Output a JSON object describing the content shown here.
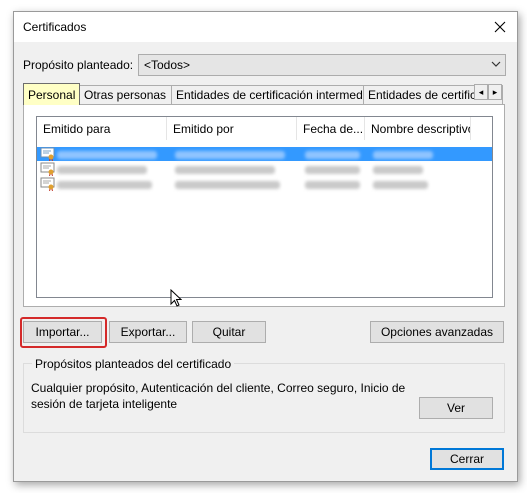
{
  "window": {
    "title": "Certificados",
    "close_glyph": "✕"
  },
  "purpose": {
    "label": "Propósito planteado:",
    "value": "<Todos>"
  },
  "tabs": [
    {
      "label": "Personal"
    },
    {
      "label": "Otras personas"
    },
    {
      "label": "Entidades de certificación intermedias"
    },
    {
      "label": "Entidades de certificaci"
    }
  ],
  "tab_scroll": {
    "left_glyph": "◂",
    "right_glyph": "▸"
  },
  "list": {
    "columns": [
      "Emitido para",
      "Emitido por",
      "Fecha de...",
      "Nombre descriptivo"
    ],
    "rows": [
      {
        "selected": true,
        "icon": "certificate-icon"
      },
      {
        "selected": false,
        "icon": "certificate-icon"
      },
      {
        "selected": false,
        "icon": "certificate-icon"
      }
    ]
  },
  "buttons": {
    "import": "Importar...",
    "export": "Exportar...",
    "remove": "Quitar",
    "advanced": "Opciones avanzadas",
    "view": "Ver",
    "close": "Cerrar"
  },
  "purposes_group": {
    "title": "Propósitos planteados del certificado",
    "text": "Cualquier propósito, Autenticación del cliente, Correo seguro, Inicio de sesión de tarjeta inteligente"
  },
  "colors": {
    "selection": "#3399ff",
    "active_tab": "#ffffc5",
    "highlight": "#d42a2a",
    "default_button_border": "#0078d7"
  }
}
